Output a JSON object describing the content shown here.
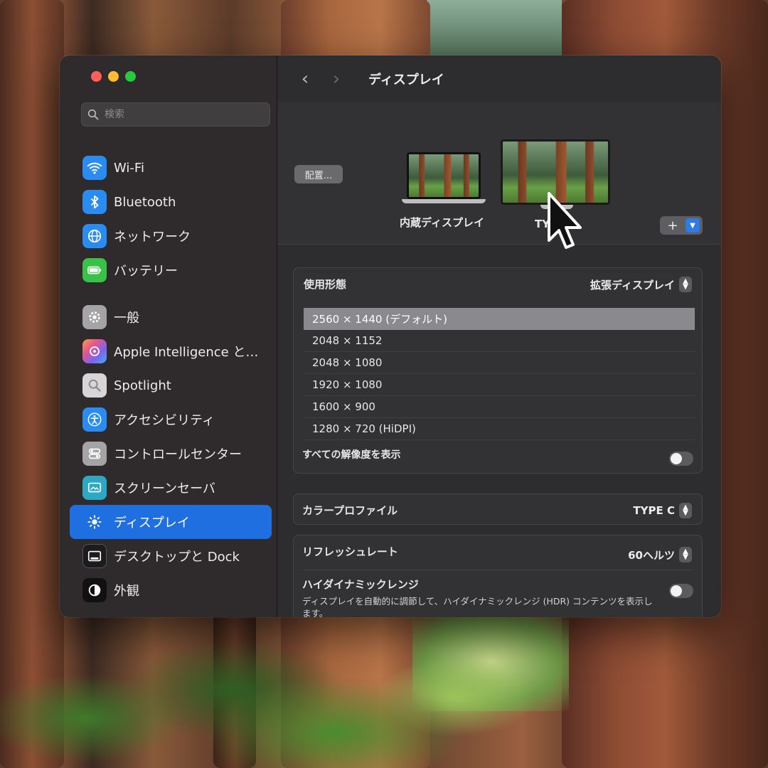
{
  "window": {
    "title": "ディスプレイ",
    "search": {
      "placeholder": "検索"
    }
  },
  "sidebar": {
    "items": [
      {
        "label": "Wi-Fi",
        "icon": "wifi-icon",
        "color": "#2a8cf0"
      },
      {
        "label": "Bluetooth",
        "icon": "bluetooth-icon",
        "color": "#2a8cf0"
      },
      {
        "label": "ネットワーク",
        "icon": "globe-icon",
        "color": "#2a8cf0"
      },
      {
        "label": "バッテリー",
        "icon": "battery-icon",
        "color": "#38c248"
      },
      {
        "label": "一般",
        "icon": "gear-icon",
        "color": "#a4a3a6"
      },
      {
        "label": "Apple Intelligence と…",
        "icon": "apple-intelligence-icon",
        "color": "#e5568c"
      },
      {
        "label": "Spotlight",
        "icon": "spotlight-icon",
        "color": "#d7d5d8"
      },
      {
        "label": "アクセシビリティ",
        "icon": "accessibility-icon",
        "color": "#2a8cf0"
      },
      {
        "label": "コントロールセンター",
        "icon": "control-center-icon",
        "color": "#a4a3a6"
      },
      {
        "label": "スクリーンセーバ",
        "icon": "screensaver-icon",
        "color": "#2aa8c4"
      },
      {
        "label": "ディスプレイ",
        "icon": "display-brightness-icon",
        "color": "#1f6fe0",
        "selected": true
      },
      {
        "label": "デスクトップと Dock",
        "icon": "dock-icon",
        "color": "#1c1c1e"
      },
      {
        "label": "外観",
        "icon": "appearance-icon",
        "color": "#111111"
      }
    ]
  },
  "displays": {
    "arrange_label": "配置...",
    "internal_label": "内蔵ディスプレイ",
    "external_label": "TYPE C",
    "add_label": "+"
  },
  "settings": {
    "usage": {
      "label": "使用形態",
      "value": "拡張ディスプレイ"
    },
    "resolutions": [
      {
        "label": "2560 × 1440 (デフォルト)",
        "selected": true
      },
      {
        "label": "2048 × 1152",
        "selected": false
      },
      {
        "label": "2048 × 1080",
        "selected": false
      },
      {
        "label": "1920 × 1080",
        "selected": false
      },
      {
        "label": "1600 × 900",
        "selected": false
      },
      {
        "label": "1280 × 720 (HiDPI)",
        "selected": false
      }
    ],
    "show_all": {
      "label": "すべての解像度を表示",
      "enabled": false
    },
    "color_profile": {
      "label": "カラープロファイル",
      "value": "TYPE C"
    },
    "refresh_rate": {
      "label": "リフレッシュレート",
      "value": "60ヘルツ"
    },
    "hdr": {
      "label": "ハイダイナミックレンジ",
      "description": "ディスプレイを自動的に調節して、ハイダイナミックレンジ (HDR) コンテンツを表示します。",
      "enabled": false
    }
  },
  "colors": {
    "accent": "#1f6fe0",
    "window_bg": "#2d2c2e",
    "sidebar_bg": "#302c2e"
  }
}
